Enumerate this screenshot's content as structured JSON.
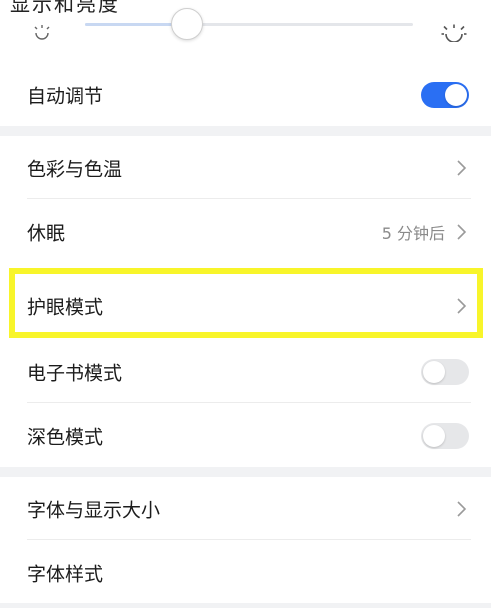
{
  "header": {
    "title": "显示和亮度"
  },
  "brightness": {
    "level_percent": 30,
    "low_icon": "sun-small-icon",
    "high_icon": "sun-large-icon"
  },
  "rows": {
    "auto_adjust": {
      "label": "自动调节",
      "toggle": "on"
    },
    "color_temp": {
      "label": "色彩与色温"
    },
    "sleep": {
      "label": "休眠",
      "value": "5 分钟后"
    },
    "eye_care": {
      "label": "护眼模式"
    },
    "ebook": {
      "label": "电子书模式",
      "toggle": "off"
    },
    "dark": {
      "label": "深色模式",
      "toggle": "off"
    },
    "font_size": {
      "label": "字体与显示大小"
    },
    "font_style": {
      "label": "字体样式"
    }
  },
  "colors": {
    "accent": "#2a6ff3",
    "highlight": "#f8f52a",
    "section_gap": "#f1f2f4"
  }
}
